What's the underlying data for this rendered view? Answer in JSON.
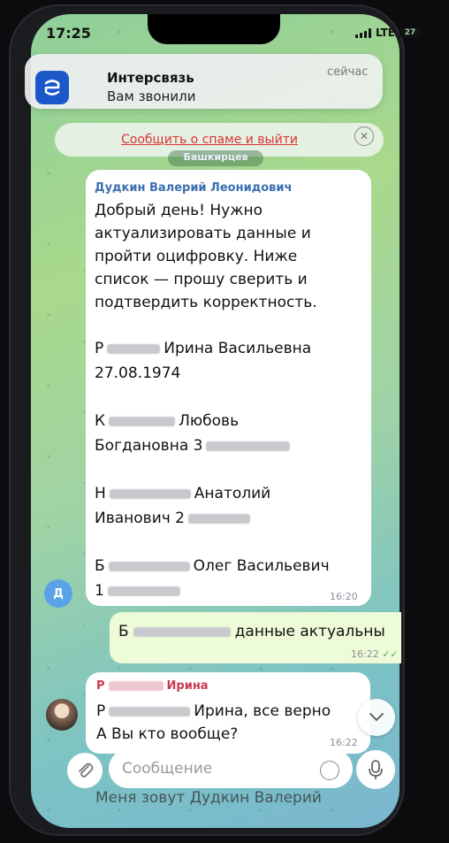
{
  "status": {
    "time": "17:25",
    "network": "LTE",
    "battery": "27"
  },
  "notification": {
    "app": "Интерсвязь",
    "body": "Вам звонили",
    "time": "сейчас"
  },
  "spam_bar": {
    "link": "Сообщить о спаме и выйти"
  },
  "chat": {
    "date_pill": "Башкирцев"
  },
  "message1": {
    "sender": "Дудкин Валерий Леонидович",
    "lines": [
      "Добрый день! Нужно",
      "актуализировать данные и",
      "пройти оцифровку. Ниже",
      "список — прошу сверить и",
      "подтвердить корректность."
    ],
    "p1_a": "Р",
    "p1_b": "Ирина Васильевна",
    "p1_c": "27.08.1974",
    "p2_a": "К",
    "p2_b": "Любовь",
    "p2_c": "Богдановна 3",
    "p3_a": "Н",
    "p3_b": "Анатолий",
    "p3_c": "Иванович 2",
    "p4_a": "Б",
    "p4_b": "Олег Васильевич",
    "p4_c": "1",
    "time": "16:20",
    "avatar": "Д"
  },
  "message2": {
    "prefix": "Б",
    "text": "данные актуальны",
    "time": "16:22"
  },
  "message3": {
    "sender_a": "Р",
    "sender_b": "Ирина",
    "line1_a": "Р",
    "line1_b": "Ирина, все верно",
    "line2": "А Вы кто вообще?",
    "time": "16:22"
  },
  "composer": {
    "placeholder": "Сообщение"
  },
  "preview_text": "Меня зовут Дудкин Валерий",
  "colors": {
    "accent": "#3a6fb0",
    "spam": "#dd3333",
    "outgoing": "#eefbd8"
  }
}
